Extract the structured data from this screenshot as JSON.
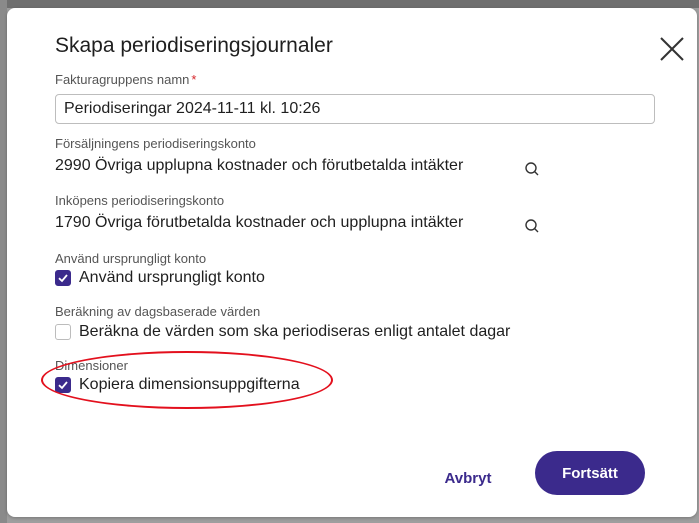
{
  "dialog": {
    "title": "Skapa periodiseringsjournaler",
    "close_icon": "close-icon"
  },
  "invoice_group": {
    "label": "Fakturagruppens namn",
    "required_marker": "*",
    "value": "Periodiseringar 2024-11-11 kl. 10:26"
  },
  "sales_account": {
    "label": "Försäljningens periodiseringskonto",
    "value": "2990 Övriga upplupna kostnader och förutbetalda intäkter",
    "icon": "search-icon"
  },
  "purchase_account": {
    "label": "Inköpens periodiseringskonto",
    "value": "1790 Övriga förutbetalda kostnader och upplupna intäkter",
    "icon": "search-icon"
  },
  "original_account": {
    "label": "Använd ursprungligt konto",
    "checkbox_label": "Använd ursprungligt konto",
    "checked": true
  },
  "day_based": {
    "label": "Beräkning av dagsbaserade värden",
    "checkbox_label": "Beräkna de värden som ska periodiseras enligt antalet dagar",
    "checked": false
  },
  "dimensions": {
    "label": "Dimensioner",
    "checkbox_label": "Kopiera dimensionsuppgifterna",
    "checked": true,
    "highlight_color": "#e3101d"
  },
  "footer": {
    "cancel_label": "Avbryt",
    "continue_label": "Fortsätt"
  },
  "colors": {
    "accent": "#3b2a8c",
    "required": "#d6262b"
  }
}
